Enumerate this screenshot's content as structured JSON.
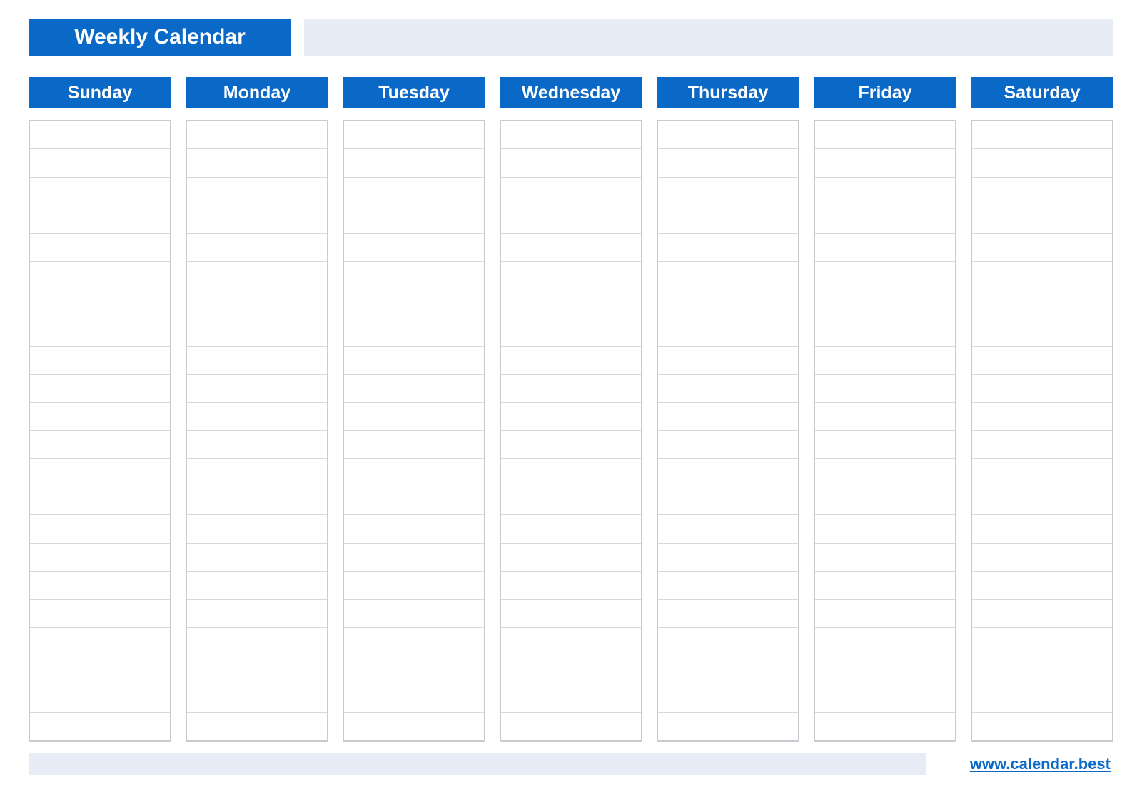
{
  "header": {
    "title": "Weekly Calendar"
  },
  "days": [
    {
      "label": "Sunday"
    },
    {
      "label": "Monday"
    },
    {
      "label": "Tuesday"
    },
    {
      "label": "Wednesday"
    },
    {
      "label": "Thursday"
    },
    {
      "label": "Friday"
    },
    {
      "label": "Saturday"
    }
  ],
  "slots_per_day": 22,
  "footer": {
    "link_text": "www.calendar.best"
  },
  "colors": {
    "accent": "#0a69c7",
    "light_band": "#e8ecf6",
    "grid_border": "#c8ccd0",
    "row_line": "#d6d9dc"
  }
}
